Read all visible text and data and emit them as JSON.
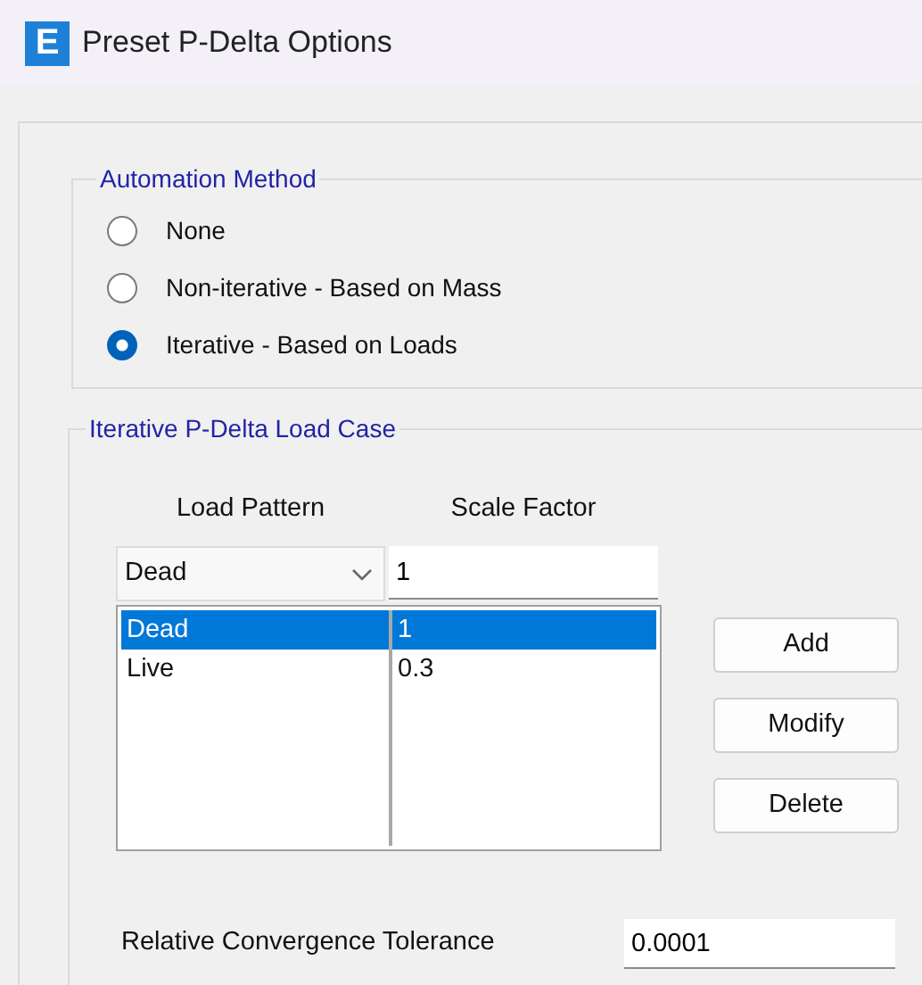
{
  "window": {
    "icon_letter": "E",
    "title": "Preset P-Delta Options"
  },
  "automation_method": {
    "title": "Automation Method",
    "options": [
      {
        "label": "None",
        "selected": false
      },
      {
        "label": "Non-iterative - Based on Mass",
        "selected": false
      },
      {
        "label": "Iterative - Based on Loads",
        "selected": true
      }
    ]
  },
  "load_case": {
    "title": "Iterative P-Delta Load Case",
    "columns": [
      "Load Pattern",
      "Scale Factor"
    ],
    "load_pattern": {
      "value": "Dead"
    },
    "scale_factor": {
      "value": "1"
    },
    "rows": [
      {
        "load_pattern": "Dead",
        "scale_factor": "1",
        "selected": true
      },
      {
        "load_pattern": "Live",
        "scale_factor": "0.3",
        "selected": false
      }
    ],
    "buttons": [
      "Add",
      "Modify",
      "Delete"
    ]
  },
  "tolerance": {
    "label": "Relative Convergence Tolerance",
    "value": "0.0001"
  }
}
